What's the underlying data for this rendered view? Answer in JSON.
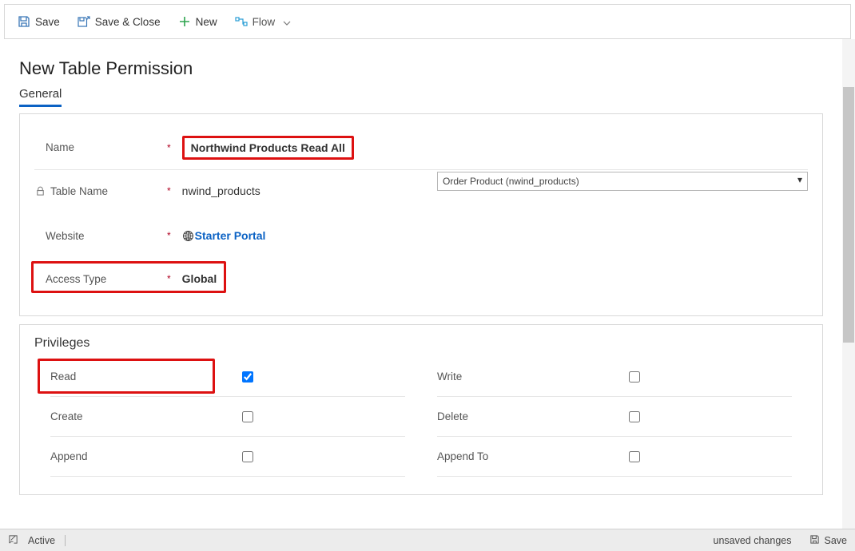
{
  "toolbar": {
    "save": "Save",
    "saveClose": "Save & Close",
    "newLabel": "New",
    "flow": "Flow"
  },
  "page": {
    "title": "New Table Permission"
  },
  "tabs": {
    "general": "General"
  },
  "general": {
    "nameLabel": "Name",
    "nameValue": "Northwind Products Read All",
    "tableLabel": "Table Name",
    "tableValue": "nwind_products",
    "tableDropdown": "Order Product (nwind_products)",
    "websiteLabel": "Website",
    "websiteValue": "Starter Portal",
    "accessTypeLabel": "Access Type",
    "accessTypeValue": "Global",
    "requiredMark": "*"
  },
  "privileges": {
    "sectionTitle": "Privileges",
    "read": "Read",
    "write": "Write",
    "create": "Create",
    "delete": "Delete",
    "append": "Append",
    "appendTo": "Append To",
    "values": {
      "read": true,
      "write": false,
      "create": false,
      "delete": false,
      "append": false,
      "appendTo": false
    }
  },
  "status": {
    "active": "Active",
    "unsaved": "unsaved changes",
    "save": "Save"
  }
}
